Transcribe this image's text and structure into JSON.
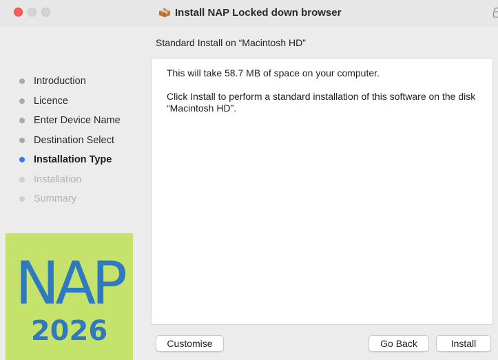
{
  "window": {
    "title": "Install NAP Locked down browser"
  },
  "subtitle": "Standard Install on “Macintosh HD”",
  "steps": [
    {
      "label": "Introduction",
      "state": "done"
    },
    {
      "label": "Licence",
      "state": "done"
    },
    {
      "label": "Enter Device Name",
      "state": "done"
    },
    {
      "label": "Destination Select",
      "state": "done"
    },
    {
      "label": "Installation Type",
      "state": "current"
    },
    {
      "label": "Installation",
      "state": "future"
    },
    {
      "label": "Summary",
      "state": "future"
    }
  ],
  "logo": {
    "text": "NAP",
    "year": "2026"
  },
  "content": {
    "line1": "This will take 58.7 MB of space on your computer.",
    "line2": "Click Install to perform a standard installation of this software on the disk “Macintosh HD”."
  },
  "buttons": {
    "customise": "Customise",
    "go_back": "Go Back",
    "install": "Install"
  },
  "colors": {
    "close": "#ff5f57",
    "current_step": "#2f7bf6",
    "logo_bg": "#c5e26b",
    "logo_text": "#2f79c1"
  },
  "icons": {
    "title_icon": "package-icon",
    "title_right": "lock-icon"
  }
}
